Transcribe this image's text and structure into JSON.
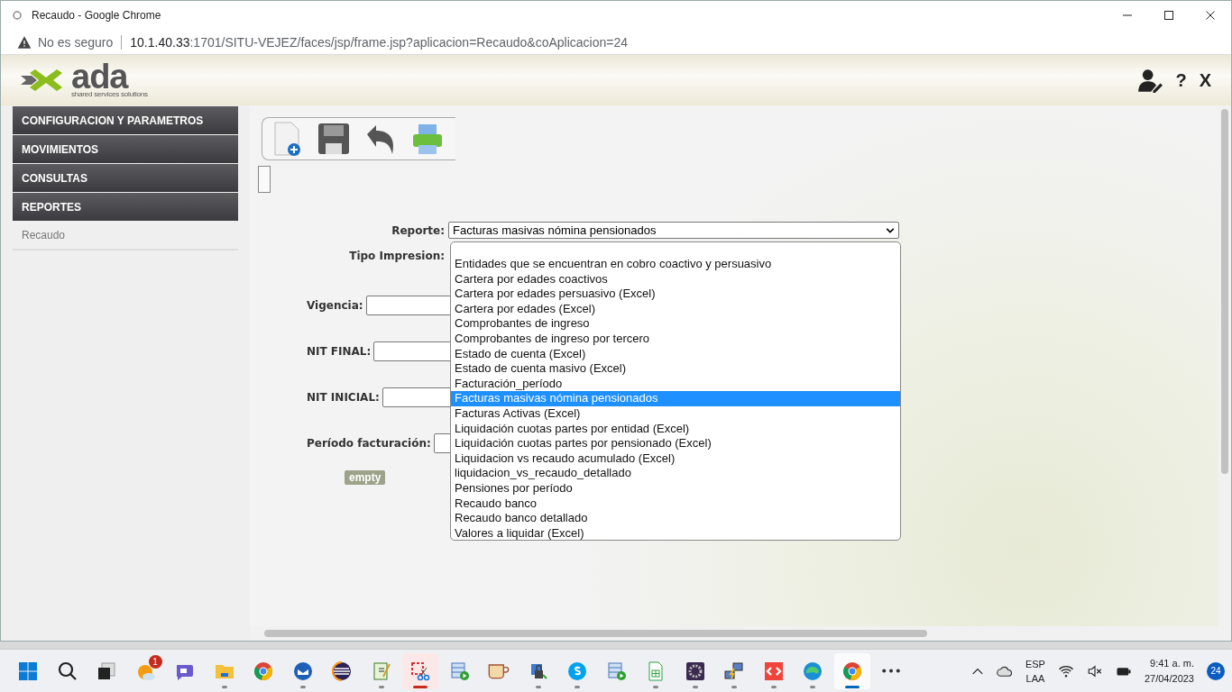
{
  "browser": {
    "window_title": "Recaudo - Google Chrome",
    "security": "No es seguro",
    "url_host": "10.1.40.33",
    "url_path": ":1701/SITU-VEJEZ/faces/jsp/frame.jsp?aplicacion=Recaudo&coAplicacion=24"
  },
  "header": {
    "logo_text": "ada",
    "logo_tagline": "shared services solutions",
    "help": "?",
    "close": "X"
  },
  "menu": [
    {
      "label": "CONFIGURACION Y PARAMETROS",
      "kind": "section"
    },
    {
      "label": "MOVIMIENTOS",
      "kind": "section"
    },
    {
      "label": "CONSULTAS",
      "kind": "section"
    },
    {
      "label": "REPORTES",
      "kind": "section"
    },
    {
      "label": "Recaudo",
      "kind": "link"
    }
  ],
  "form": {
    "report_label": "Reporte:",
    "report_value": "Facturas masivas nómina pensionados",
    "print_type_label": "Tipo Impresion:",
    "fields": [
      {
        "label": "Vigencia:"
      },
      {
        "label": "NIT FINAL:"
      },
      {
        "label": "NIT INICIAL:"
      },
      {
        "label": "Período facturación:"
      }
    ],
    "note": "empty"
  },
  "dropdown": {
    "options": [
      {
        "label": "Entidades que se encuentran en cobro coactivo y persuasivo",
        "selected": false
      },
      {
        "label": "Cartera por edades coactivos",
        "selected": false
      },
      {
        "label": "Cartera por edades persuasivo (Excel)",
        "selected": false
      },
      {
        "label": "Cartera por edades (Excel)",
        "selected": false
      },
      {
        "label": "Comprobantes de ingreso",
        "selected": false
      },
      {
        "label": "Comprobantes de ingreso por tercero",
        "selected": false
      },
      {
        "label": "Estado de cuenta (Excel)",
        "selected": false
      },
      {
        "label": "Estado de cuenta masivo (Excel)",
        "selected": false
      },
      {
        "label": "Facturación_período",
        "selected": false
      },
      {
        "label": "Facturas masivas nómina pensionados",
        "selected": true
      },
      {
        "label": "Facturas Activas (Excel)",
        "selected": false
      },
      {
        "label": "Liquidación cuotas partes por entidad (Excel)",
        "selected": false
      },
      {
        "label": "Liquidación cuotas partes por pensionado (Excel)",
        "selected": false
      },
      {
        "label": "Liquidacion vs recaudo acumulado (Excel)",
        "selected": false
      },
      {
        "label": "liquidacion_vs_recaudo_detallado",
        "selected": false
      },
      {
        "label": "Pensiones por período",
        "selected": false
      },
      {
        "label": "Recaudo banco",
        "selected": false
      },
      {
        "label": "Recaudo banco detallado",
        "selected": false
      },
      {
        "label": "Valores a liquidar (Excel)",
        "selected": false
      }
    ]
  },
  "taskbar": {
    "apps": [
      {
        "kind": "start",
        "running": false,
        "selected": false
      },
      {
        "kind": "search",
        "running": false,
        "selected": false
      },
      {
        "kind": "taskview",
        "running": false,
        "selected": false
      },
      {
        "kind": "weather",
        "running": false,
        "selected": false,
        "badge": "1"
      },
      {
        "kind": "chat",
        "running": false,
        "selected": false
      },
      {
        "kind": "folder",
        "running": true,
        "selected": false
      },
      {
        "kind": "chrome",
        "running": false,
        "selected": false
      },
      {
        "kind": "mail",
        "running": true,
        "selected": false
      },
      {
        "kind": "eclipse",
        "running": false,
        "selected": false
      },
      {
        "kind": "notepad",
        "running": true,
        "selected": false
      },
      {
        "kind": "snip",
        "running": true,
        "selected": true
      },
      {
        "kind": "db",
        "running": false,
        "selected": false
      },
      {
        "kind": "cup",
        "running": false,
        "selected": false
      },
      {
        "kind": "lock",
        "running": true,
        "selected": false
      },
      {
        "kind": "skype",
        "running": true,
        "selected": false
      },
      {
        "kind": "db",
        "running": false,
        "selected": false
      },
      {
        "kind": "sheet",
        "running": true,
        "selected": false
      },
      {
        "kind": "gear",
        "running": true,
        "selected": false
      },
      {
        "kind": "network",
        "running": true,
        "selected": false
      },
      {
        "kind": "remote",
        "running": true,
        "selected": false
      },
      {
        "kind": "edge",
        "running": true,
        "selected": false
      },
      {
        "kind": "chrome",
        "running": true,
        "selected": true
      },
      {
        "kind": "more",
        "running": false,
        "selected": false
      }
    ],
    "language": "ESP",
    "layout": "LAA",
    "time": "9:41 a. m.",
    "date": "27/04/2023",
    "notifications": "24"
  }
}
